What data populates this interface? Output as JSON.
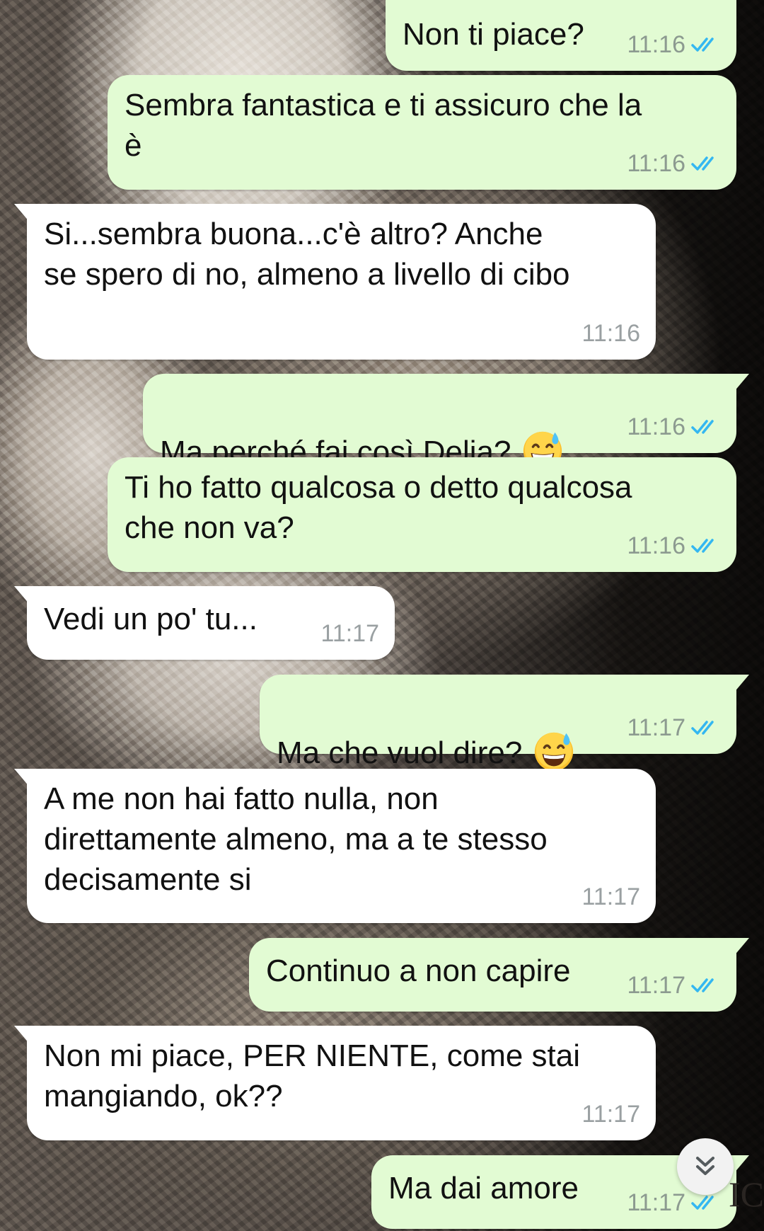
{
  "messages": [
    {
      "direction": "out",
      "text": "Non ti piace?",
      "time": "11:16",
      "status": "read"
    },
    {
      "direction": "out",
      "text": "Sembra fantastica e ti assicuro che la\nè",
      "time": "11:16",
      "status": "read"
    },
    {
      "direction": "in",
      "text": "Si...sembra buona...c'è altro? Anche\nse spero di no, almeno a livello di cibo",
      "time": "11:16"
    },
    {
      "direction": "out",
      "text": "Ma perché fai così Delia?",
      "emoji": "grinning-face-with-sweat",
      "time": "11:16",
      "status": "read"
    },
    {
      "direction": "out",
      "text": "Ti ho fatto qualcosa o detto qualcosa\nche non va?",
      "time": "11:16",
      "status": "read"
    },
    {
      "direction": "in",
      "text": "Vedi un po' tu...",
      "time": "11:17"
    },
    {
      "direction": "out",
      "text": "Ma che vuol dire?",
      "emoji": "grinning-face-with-sweat",
      "time": "11:17",
      "status": "read"
    },
    {
      "direction": "in",
      "text": "A me non hai fatto nulla, non\ndirettamente almeno, ma a te stesso\ndecisamente si",
      "time": "11:17"
    },
    {
      "direction": "out",
      "text": "Continuo a non capire",
      "time": "11:17",
      "status": "read"
    },
    {
      "direction": "in",
      "text": "Non mi piace, PER NIENTE, come stai\nmangiando, ok??",
      "time": "11:17"
    },
    {
      "direction": "out",
      "text": "Ma dai amore",
      "time": "11:17",
      "status": "read"
    }
  ],
  "colors": {
    "outgoing_bubble": "#e2fbd3",
    "incoming_bubble": "#ffffff",
    "read_ticks": "#34b7f1",
    "time_text": "#8c9a90"
  },
  "icons": {
    "read_receipt": "double-check-icon",
    "scroll_button": "double-chevron-down-icon",
    "emoji": "grinning-face-with-sweat-emoji"
  },
  "wallpaper_edge_text": "IC"
}
